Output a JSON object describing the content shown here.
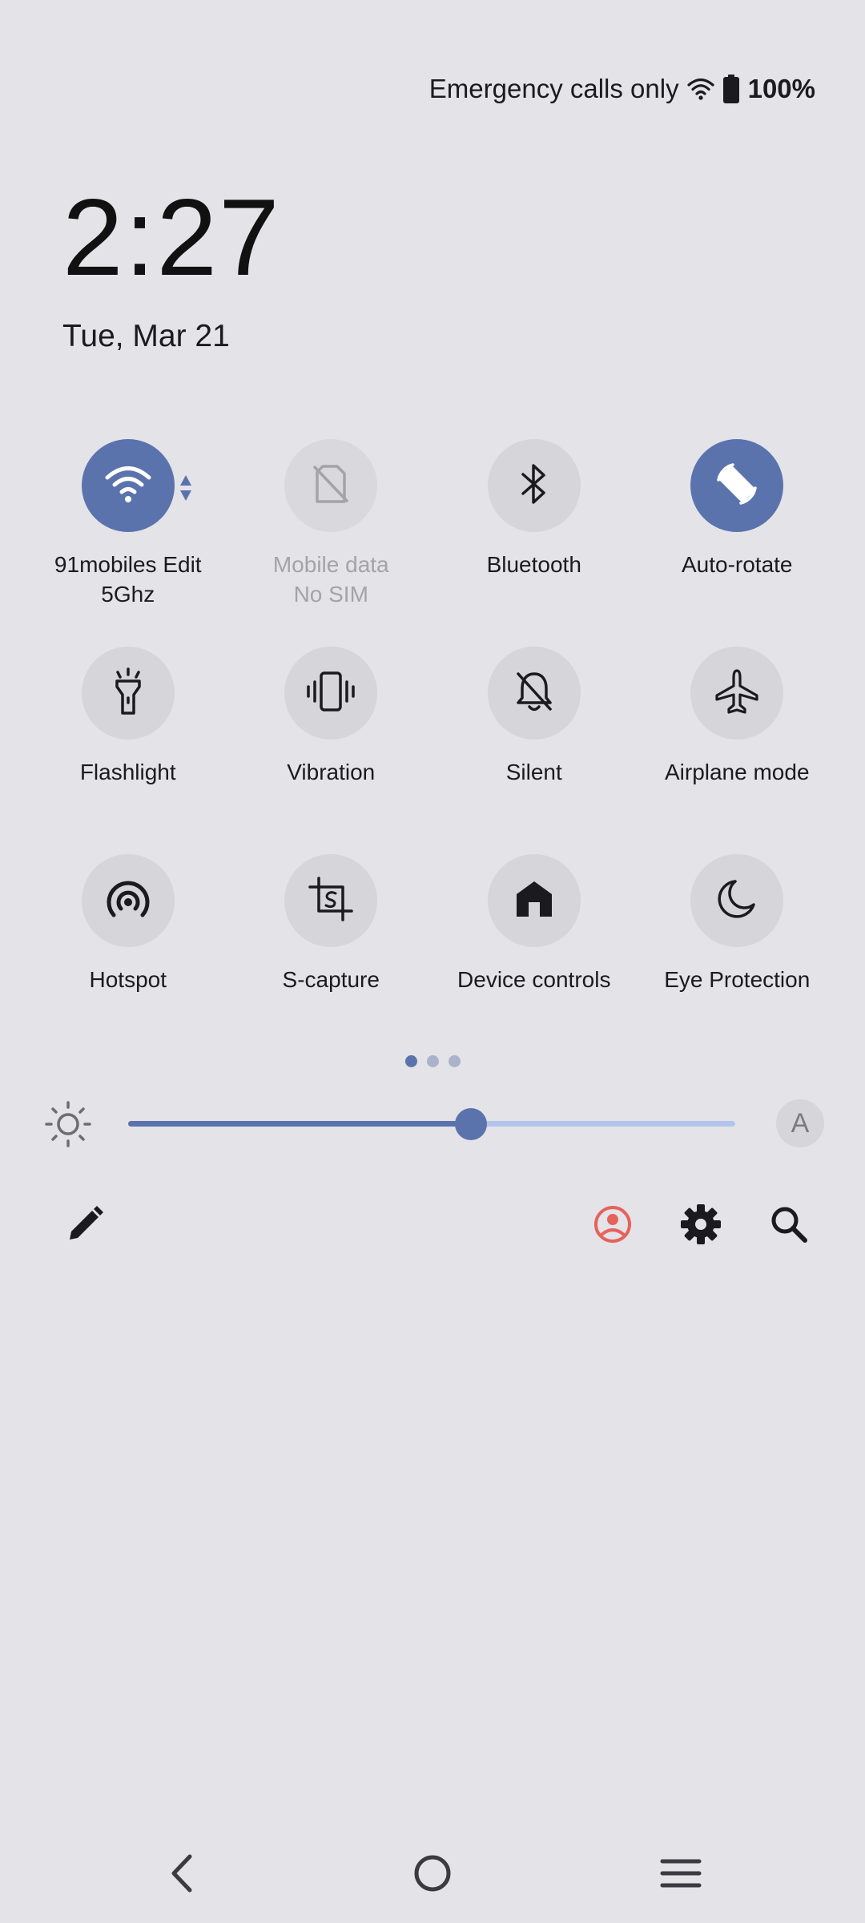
{
  "status_bar": {
    "carrier": "Emergency calls only",
    "battery": "100%",
    "icons": [
      "wifi-icon",
      "battery-icon"
    ]
  },
  "clock": {
    "time": "2:27",
    "date": "Tue, Mar 21"
  },
  "tiles": [
    {
      "label": "91mobiles Edit",
      "sub": "5Ghz",
      "icon": "wifi-icon",
      "state": "on"
    },
    {
      "label": "Mobile data",
      "sub": "No SIM",
      "icon": "no-sim-icon",
      "state": "unavailable"
    },
    {
      "label": "Bluetooth",
      "icon": "bluetooth-icon",
      "state": "off"
    },
    {
      "label": "Auto-rotate",
      "icon": "auto-rotate-icon",
      "state": "on"
    },
    {
      "label": "Flashlight",
      "icon": "flashlight-icon",
      "state": "off"
    },
    {
      "label": "Vibration",
      "icon": "vibration-icon",
      "state": "off"
    },
    {
      "label": "Silent",
      "icon": "bell-off-icon",
      "state": "off"
    },
    {
      "label": "Airplane mode",
      "icon": "airplane-icon",
      "state": "off"
    },
    {
      "label": "Hotspot",
      "icon": "hotspot-icon",
      "state": "off"
    },
    {
      "label": "S-capture",
      "icon": "screenshot-crop-icon",
      "state": "off"
    },
    {
      "label": "Device controls",
      "icon": "home-icon",
      "state": "off"
    },
    {
      "label": "Eye Protection",
      "icon": "moon-icon",
      "state": "off"
    }
  ],
  "pages": {
    "count": 3,
    "current": 1
  },
  "brightness": {
    "level": 0.565,
    "auto_label": "A"
  },
  "toolbar": {
    "icons": [
      "pencil-icon",
      "user-profile-icon",
      "gear-icon",
      "search-icon"
    ],
    "user_color": "#e5635c"
  },
  "navigation": {
    "icons": [
      "back-icon",
      "home-circle-icon",
      "menu-icon"
    ]
  },
  "colors": {
    "background": "#e4e3e8",
    "accent": "#5b73ad",
    "tile_off": "#d6d5da",
    "track": "#b3c4ec"
  }
}
